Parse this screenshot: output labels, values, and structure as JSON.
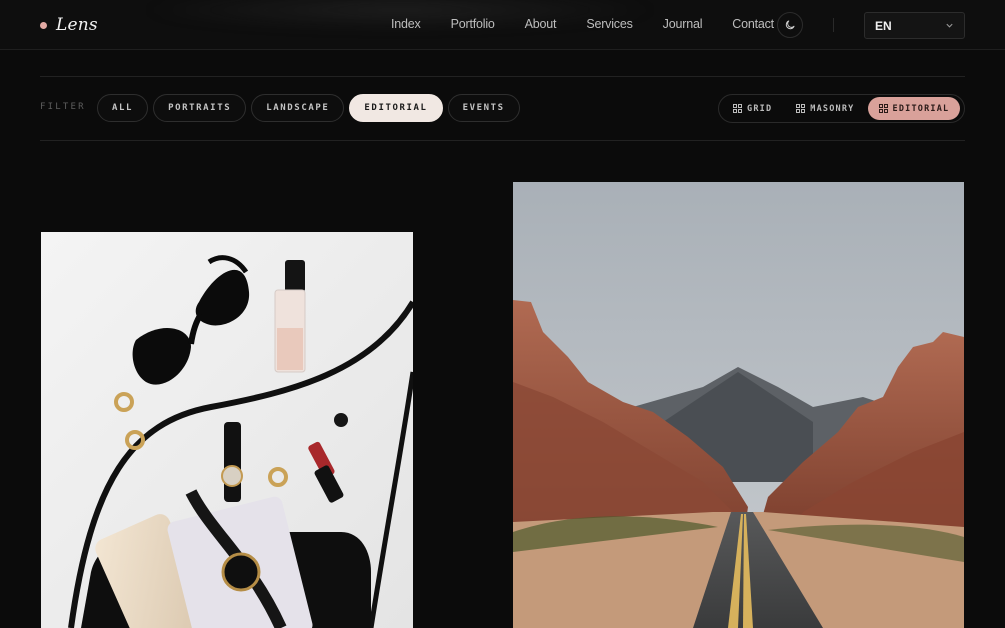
{
  "brand": {
    "name": "Lens",
    "dot_color": "#e2a9a3"
  },
  "nav": [
    "Index",
    "Portfolio",
    "About",
    "Services",
    "Journal",
    "Contact"
  ],
  "header": {
    "theme_icon": "moon-icon",
    "language": "EN",
    "language_icon": "chevron-down-icon"
  },
  "filter": {
    "label": "FILTER",
    "chips": [
      "ALL",
      "PORTRAITS",
      "LANDSCAPE",
      "EDITORIAL",
      "EVENTS"
    ],
    "active": "EDITORIAL"
  },
  "views": {
    "options": [
      "GRID",
      "MASONRY",
      "EDITORIAL"
    ],
    "active": "EDITORIAL",
    "icon": "grid-icon",
    "accent": "#d9a19a"
  },
  "gallery": [
    {
      "subject": "flat-lay accessories"
    },
    {
      "subject": "desert road through red rock canyon"
    }
  ]
}
